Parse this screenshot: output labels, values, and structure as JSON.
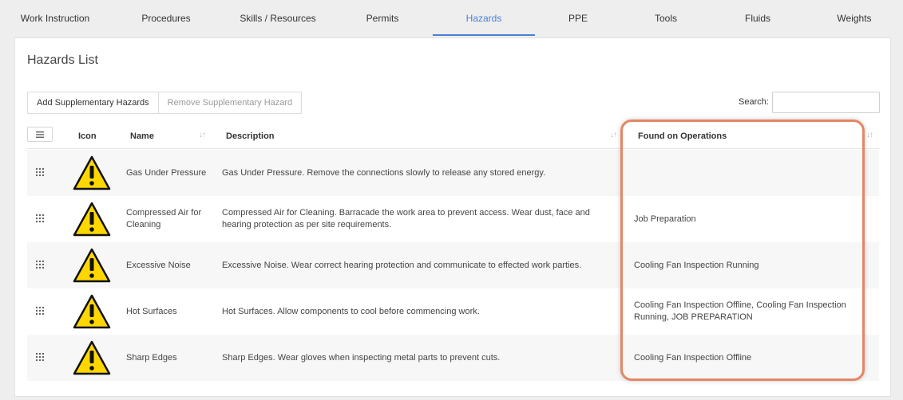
{
  "tabs": [
    {
      "label": "Work Instruction"
    },
    {
      "label": "Procedures"
    },
    {
      "label": "Skills / Resources"
    },
    {
      "label": "Permits"
    },
    {
      "label": "Hazards"
    },
    {
      "label": "PPE"
    },
    {
      "label": "Tools"
    },
    {
      "label": "Fluids"
    },
    {
      "label": "Weights"
    }
  ],
  "active_tab": "Hazards",
  "accent_color": "#4a7fd6",
  "highlight_color": "#e38764",
  "panel": {
    "title": "Hazards List",
    "add_button": "Add Supplementary Hazards",
    "remove_button": "Remove Supplementary Hazard",
    "search_label": "Search:",
    "search_value": ""
  },
  "columns": {
    "icon": "Icon",
    "name": "Name",
    "description": "Description",
    "operations": "Found on Operations"
  },
  "rows": [
    {
      "icon": "warning-triangle-icon",
      "name": "Gas Under Pressure",
      "description": "Gas Under Pressure. Remove the connections slowly to release any stored energy.",
      "operations": ""
    },
    {
      "icon": "warning-triangle-icon",
      "name": "Compressed Air for Cleaning",
      "description": "Compressed Air for Cleaning. Barracade the work area to prevent access. Wear dust, face and hearing protection as per site requirements.",
      "operations": "Job Preparation"
    },
    {
      "icon": "warning-triangle-icon",
      "name": "Excessive Noise",
      "description": "Excessive Noise. Wear correct hearing protection and communicate to effected work parties.",
      "operations": "Cooling Fan Inspection Running"
    },
    {
      "icon": "warning-triangle-icon",
      "name": "Hot Surfaces",
      "description": "Hot Surfaces. Allow components to cool before commencing work.",
      "operations": "Cooling Fan Inspection Offline, Cooling Fan Inspection Running, JOB PREPARATION"
    },
    {
      "icon": "warning-triangle-icon",
      "name": "Sharp Edges",
      "description": "Sharp Edges. Wear gloves when inspecting metal parts to prevent cuts.",
      "operations": "Cooling Fan Inspection Offline"
    }
  ]
}
